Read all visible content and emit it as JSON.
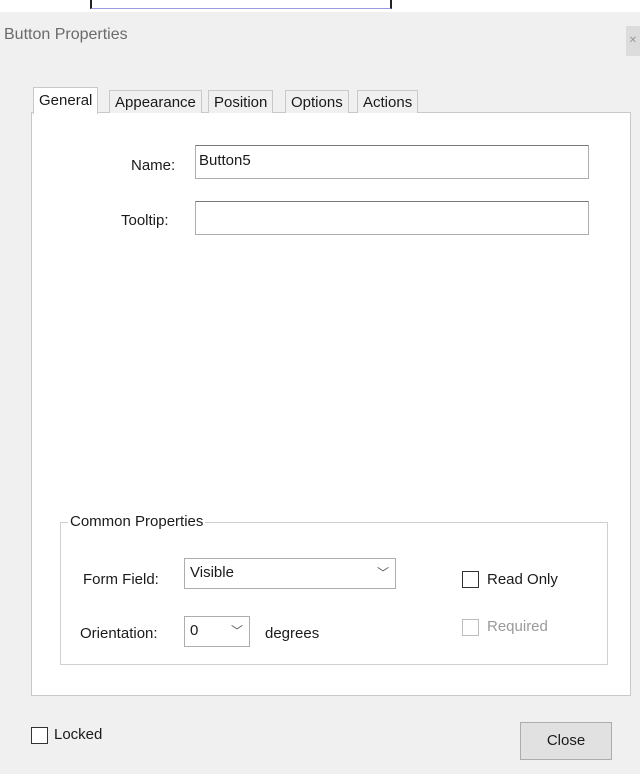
{
  "window": {
    "title": "Button Properties"
  },
  "tabs": [
    {
      "label": "General"
    },
    {
      "label": "Appearance"
    },
    {
      "label": "Position"
    },
    {
      "label": "Options"
    },
    {
      "label": "Actions"
    }
  ],
  "general": {
    "name_label": "Name:",
    "name_value": "Button5",
    "tooltip_label": "Tooltip:",
    "tooltip_value": ""
  },
  "common_properties": {
    "legend": "Common Properties",
    "form_field_label": "Form Field:",
    "form_field_value": "Visible",
    "orientation_label": "Orientation:",
    "orientation_value": "0",
    "degrees_label": "degrees",
    "read_only_label": "Read Only",
    "read_only_checked": false,
    "required_label": "Required",
    "required_enabled": false
  },
  "footer": {
    "locked_label": "Locked",
    "locked_checked": false,
    "close_label": "Close"
  },
  "icons": {
    "dropdown": "chevron-down-icon",
    "close": "close-icon"
  }
}
